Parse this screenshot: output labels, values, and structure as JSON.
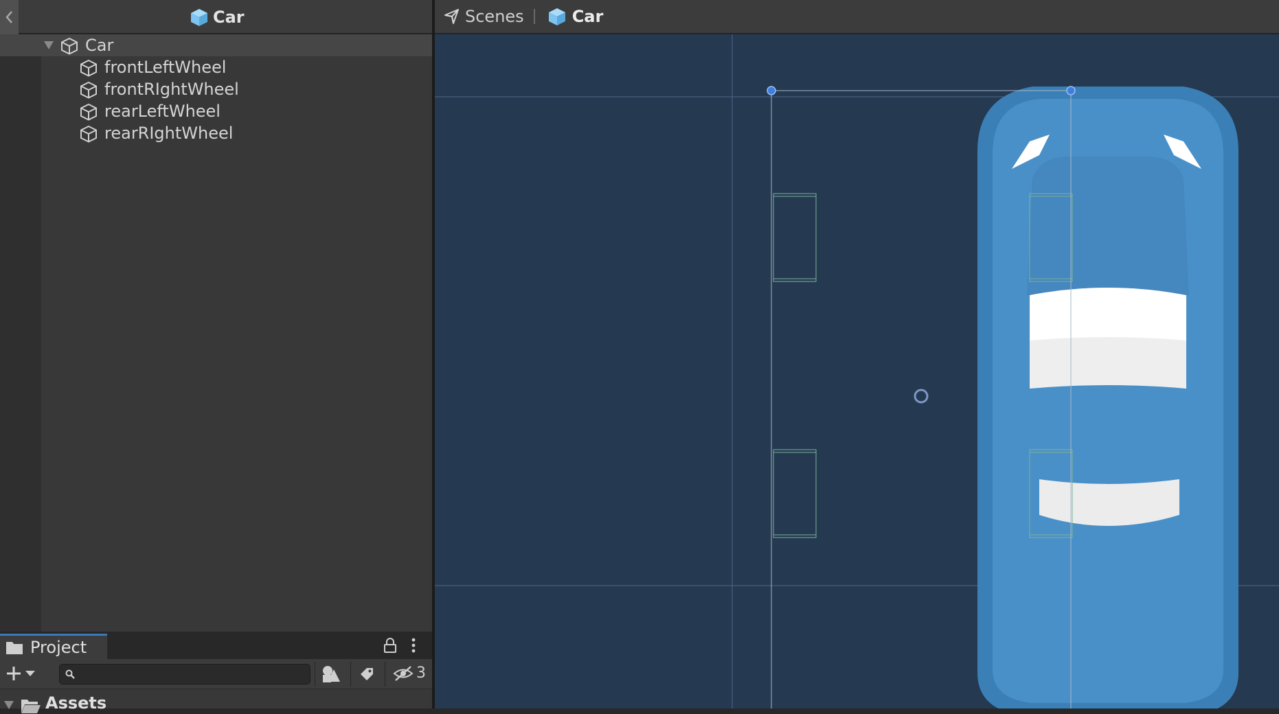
{
  "hierarchy": {
    "title": "Car",
    "root": {
      "label": "Car",
      "expanded": true
    },
    "children": [
      {
        "label": "frontLeftWheel"
      },
      {
        "label": "frontRIghtWheel"
      },
      {
        "label": "rearLeftWheel"
      },
      {
        "label": "rearRIghtWheel"
      }
    ]
  },
  "project": {
    "tab_label": "Project",
    "search": {
      "value": "",
      "placeholder": ""
    },
    "hidden_count": "3",
    "assets_label": "Assets"
  },
  "scene": {
    "breadcrumb": [
      {
        "label": "Scenes",
        "icon": "unity-logo-icon"
      },
      {
        "label": "Car",
        "icon": "prefab-cube-icon"
      }
    ]
  },
  "colors": {
    "prefab_icon": "#7fc4f0",
    "scene_background": "#253951",
    "car_body": "#4a90c8",
    "selection_handle": "#3d7fe0",
    "tab_accent": "#3a79bb"
  }
}
